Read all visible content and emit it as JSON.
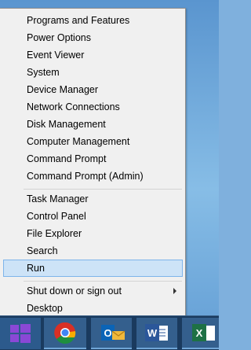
{
  "menu": {
    "group1": [
      {
        "label": "Programs and Features"
      },
      {
        "label": "Power Options"
      },
      {
        "label": "Event Viewer"
      },
      {
        "label": "System"
      },
      {
        "label": "Device Manager"
      },
      {
        "label": "Network Connections"
      },
      {
        "label": "Disk Management"
      },
      {
        "label": "Computer Management"
      },
      {
        "label": "Command Prompt"
      },
      {
        "label": "Command Prompt (Admin)"
      }
    ],
    "group2": [
      {
        "label": "Task Manager"
      },
      {
        "label": "Control Panel"
      },
      {
        "label": "File Explorer"
      },
      {
        "label": "Search"
      },
      {
        "label": "Run",
        "highlighted": true
      }
    ],
    "group3": [
      {
        "label": "Shut down or sign out",
        "has_submenu": true
      },
      {
        "label": "Desktop"
      }
    ]
  },
  "taskbar": {
    "apps": [
      {
        "name": "chrome-icon"
      },
      {
        "name": "outlook-icon",
        "letter": "O"
      },
      {
        "name": "word-icon",
        "letter": "W"
      },
      {
        "name": "excel-icon",
        "letter": "X"
      }
    ]
  },
  "colors": {
    "highlight": "#cde3f7",
    "taskbar": "#1a3a5e",
    "start_tile": "#7b3fc9"
  }
}
